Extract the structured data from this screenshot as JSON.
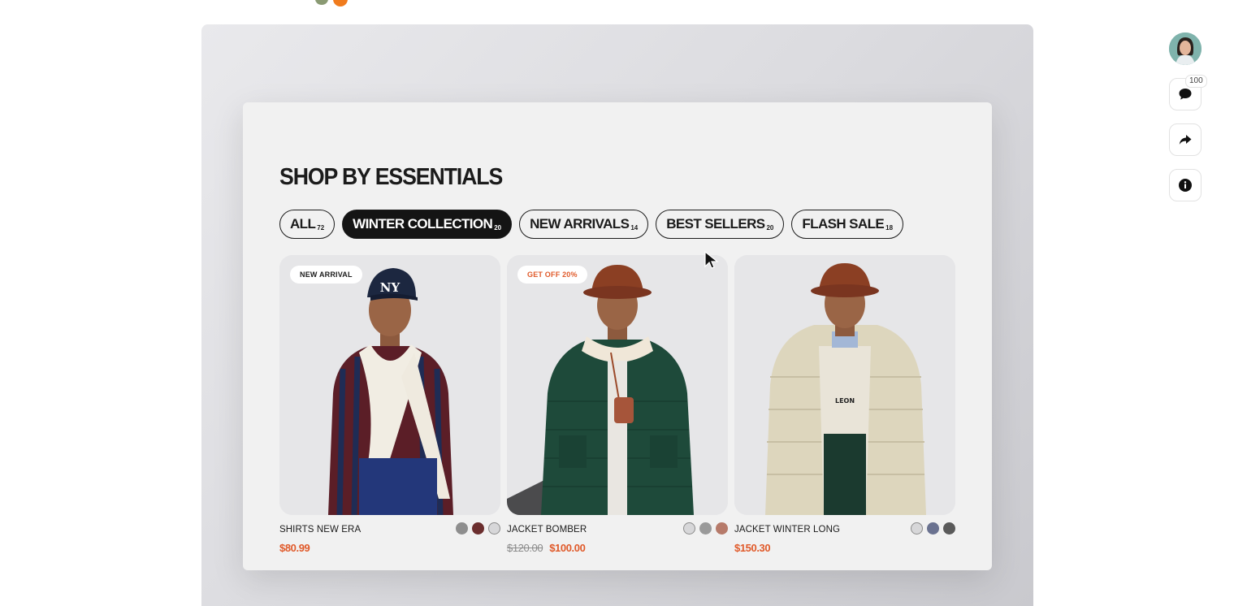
{
  "section": {
    "title": "SHOP BY ESSENTIALS"
  },
  "tabs": [
    {
      "label": "ALL",
      "count": "72"
    },
    {
      "label": "WINTER COLLECTION",
      "count": "20"
    },
    {
      "label": "NEW ARRIVALS",
      "count": "14"
    },
    {
      "label": "BEST SELLERS",
      "count": "20"
    },
    {
      "label": "FLASH SALE",
      "count": "18"
    }
  ],
  "active_tab": "WINTER COLLECTION",
  "products": [
    {
      "badge": "NEW ARRIVAL",
      "name": "SHIRTS NEW ERA",
      "price": "$80.99",
      "swatches": [
        "#8e8e8e",
        "#6b2e2e",
        "#d7d7d9"
      ],
      "selected_swatch": 2
    },
    {
      "badge": "GET OFF 20%",
      "name": "JACKET BOMBER",
      "old_price": "$120.00",
      "price": "$100.00",
      "swatches": [
        "#d7d7d9",
        "#9a9a9a",
        "#b67a6a"
      ],
      "selected_swatch": 0
    },
    {
      "name": "JACKET WINTER LONG",
      "price": "$150.30",
      "swatches": [
        "#d7d7d9",
        "#6a7290",
        "#5a5a5a"
      ],
      "selected_swatch": 0
    }
  ],
  "side_rail": {
    "comment_count": "100",
    "icons": [
      "avatar",
      "comment-icon",
      "share-icon",
      "info-icon"
    ]
  },
  "colors": {
    "accent": "#e05a2a",
    "active_tab_bg": "#141414",
    "card_bg": "#f1f1f1"
  }
}
